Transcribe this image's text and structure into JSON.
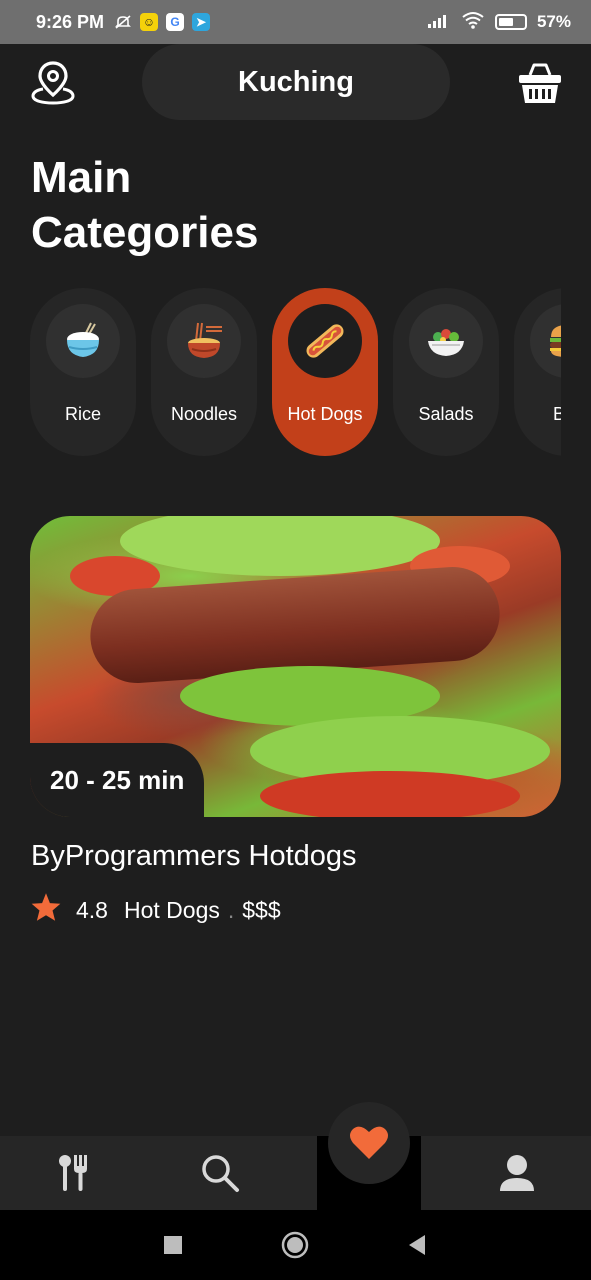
{
  "status_bar": {
    "time": "9:26 PM",
    "battery_percent": "57%",
    "battery_level": 0.57,
    "icons": [
      "mute-icon",
      "smiley-app-icon",
      "google-icon",
      "telegram-icon",
      "signal-icon",
      "wifi-icon",
      "battery-icon"
    ]
  },
  "header": {
    "city": "Kuching",
    "left_icon": "location-pin-icon",
    "right_icon": "basket-icon"
  },
  "main_title": {
    "line1": "Main",
    "line2": "Categories"
  },
  "categories": [
    {
      "label": "Rice",
      "icon": "rice-bowl-icon",
      "active": false
    },
    {
      "label": "Noodles",
      "icon": "noodles-icon",
      "active": false
    },
    {
      "label": "Hot Dogs",
      "icon": "hot-dog-icon",
      "active": true
    },
    {
      "label": "Salads",
      "icon": "salad-icon",
      "active": false
    },
    {
      "label": "Bur",
      "icon": "burger-icon",
      "active": false
    }
  ],
  "restaurant": {
    "delivery_time": "20 - 25 min",
    "name": "ByProgrammers Hotdogs",
    "rating": "4.8",
    "category": "Hot Dogs",
    "separator": ".",
    "price": "$$$"
  },
  "bottom_nav": {
    "items": [
      "cutlery-icon",
      "search-icon",
      "heart-icon",
      "user-icon"
    ]
  },
  "colors": {
    "background": "#1e1e1e",
    "surface": "#262626",
    "accent": "#c2401a",
    "star": "#f26b3a",
    "heart": "#f26b3a"
  }
}
